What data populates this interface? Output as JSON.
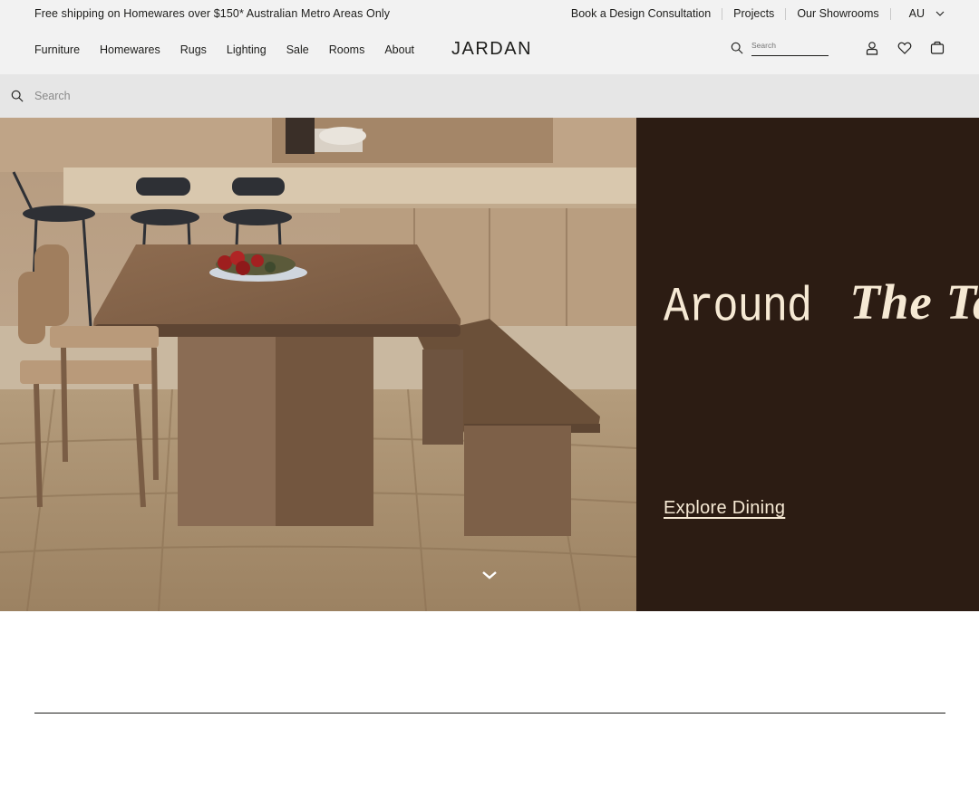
{
  "topbar": {
    "promo": "Free shipping on Homewares over $150* Australian Metro Areas Only",
    "links": [
      "Book a Design Consultation",
      "Projects",
      "Our Showrooms"
    ],
    "country": "AU"
  },
  "nav": {
    "menu": [
      "Furniture",
      "Homewares",
      "Rugs",
      "Lighting",
      "Sale",
      "Rooms",
      "About"
    ],
    "logo": "JARDAN",
    "search_placeholder": "Search"
  },
  "searchbar": {
    "placeholder": "Search"
  },
  "hero": {
    "title_part1": "Around",
    "title_part2": "The Table",
    "cta": "Explore Dining",
    "panel_color": "#2c1c13",
    "text_color": "#f6e9d4"
  },
  "icons": [
    "search-icon",
    "account-icon",
    "wishlist-icon",
    "cart-icon",
    "chevron-down-icon",
    "scroll-down-icon"
  ]
}
